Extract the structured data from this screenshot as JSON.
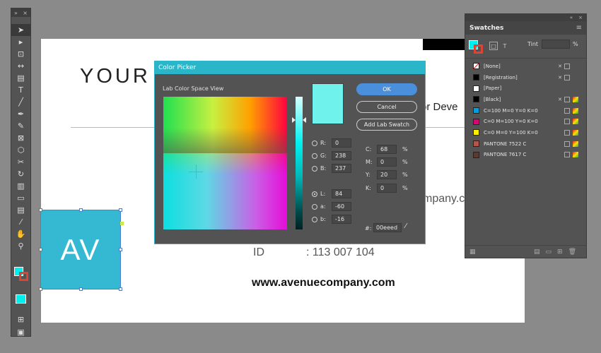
{
  "document": {
    "heading": "YOUR",
    "tagline": "or Deve",
    "company_text": "mpany.c",
    "id_label": "ID",
    "id_value": ": 113 007 104",
    "website": "www.avenuecompany.com",
    "logo_text": "AV",
    "logo_color": "#35b9d3"
  },
  "toolbar": {
    "tools": [
      "selection-tool",
      "direct-selection-tool",
      "page-tool",
      "gap-tool",
      "content-collector-tool",
      "type-tool",
      "line-tool",
      "pen-tool",
      "pencil-tool",
      "rectangle-frame-tool",
      "ellipse-tool",
      "scissors-tool",
      "free-transform-tool",
      "gradient-swatch-tool",
      "gradient-feather-tool",
      "note-tool",
      "eyedropper-tool",
      "hand-tool",
      "zoom-tool"
    ],
    "fill_color": "#00eeed"
  },
  "color_picker": {
    "title": "Color Picker",
    "view_label": "Lab Color Space View",
    "ok_label": "OK",
    "cancel_label": "Cancel",
    "add_swatch_label": "Add Lab Swatch",
    "preview_color": "#6ff2ec",
    "rgb": {
      "R": "0",
      "G": "238",
      "B": "237"
    },
    "lab": {
      "L": "84",
      "a": "-60",
      "b": "-16"
    },
    "cmyk": {
      "C": "68",
      "M": "0",
      "Y": "20",
      "K": "0"
    },
    "labels": {
      "R": "R:",
      "G": "G:",
      "B": "B:",
      "L": "L:",
      "a": "a:",
      "b": "b:",
      "C": "C:",
      "M": "M:",
      "Y": "Y:",
      "K": "K:",
      "pct": "%",
      "hex": "#:"
    },
    "hex": "00eeed"
  },
  "swatches_panel": {
    "title": "Swatches",
    "tint_label": "Tint",
    "tint_unit": "%",
    "items": [
      {
        "name": "[None]",
        "color": "#ffffff"
      },
      {
        "name": "[Registration]",
        "color": "#000000"
      },
      {
        "name": "[Paper]",
        "color": "#ffffff"
      },
      {
        "name": "[Black]",
        "color": "#000000"
      },
      {
        "name": "C=100 M=0 Y=0 K=0",
        "color": "#00a0e0"
      },
      {
        "name": "C=0 M=100 Y=0 K=0",
        "color": "#e0007a"
      },
      {
        "name": "C=0 M=0 Y=100 K=0",
        "color": "#fff200"
      },
      {
        "name": "PANTONE 7522 C",
        "color": "#b0564a"
      },
      {
        "name": "PANTONE 7617 C",
        "color": "#5c3a34"
      }
    ]
  }
}
